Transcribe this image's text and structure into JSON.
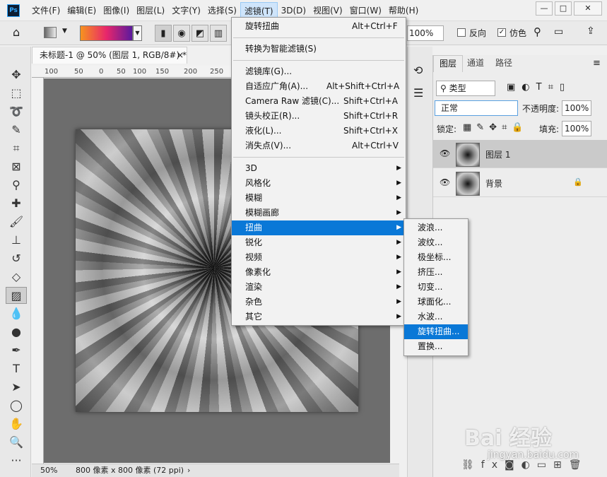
{
  "menubar": {
    "logo": "Ps",
    "items": [
      "文件(F)",
      "编辑(E)",
      "图像(I)",
      "图层(L)",
      "文字(Y)",
      "选择(S)",
      "滤镜(T)",
      "3D(D)",
      "视图(V)",
      "窗口(W)",
      "帮助(H)"
    ],
    "active_index": 6,
    "window_buttons": [
      "—",
      "□",
      "✕"
    ]
  },
  "options": {
    "zoom": "100%",
    "reverse": "反向",
    "dither": "仿色"
  },
  "document": {
    "tab_title": "未标题-1 @ 50% (图层 1, RGB/8#) *",
    "ruler_ticks": [
      "100",
      "50",
      "0",
      "50",
      "100",
      "150",
      "200",
      "250"
    ],
    "status_zoom": "50%",
    "status_info": "800 像素 x 800 像素 (72 ppi)"
  },
  "filter_menu": {
    "items": [
      {
        "label": "旋转扭曲",
        "shortcut": "Alt+Ctrl+F"
      },
      {
        "label": "转换为智能滤镜(S)",
        "shortcut": ""
      },
      {
        "label": "滤镜库(G)...",
        "shortcut": ""
      },
      {
        "label": "自适应广角(A)...",
        "shortcut": "Alt+Shift+Ctrl+A"
      },
      {
        "label": "Camera Raw 滤镜(C)...",
        "shortcut": "Shift+Ctrl+A"
      },
      {
        "label": "镜头校正(R)...",
        "shortcut": "Shift+Ctrl+R"
      },
      {
        "label": "液化(L)...",
        "shortcut": "Shift+Ctrl+X"
      },
      {
        "label": "消失点(V)...",
        "shortcut": "Alt+Ctrl+V"
      },
      {
        "label": "3D",
        "shortcut": ""
      },
      {
        "label": "风格化",
        "shortcut": ""
      },
      {
        "label": "模糊",
        "shortcut": ""
      },
      {
        "label": "模糊画廊",
        "shortcut": ""
      },
      {
        "label": "扭曲",
        "shortcut": ""
      },
      {
        "label": "锐化",
        "shortcut": ""
      },
      {
        "label": "视频",
        "shortcut": ""
      },
      {
        "label": "像素化",
        "shortcut": ""
      },
      {
        "label": "渲染",
        "shortcut": ""
      },
      {
        "label": "杂色",
        "shortcut": ""
      },
      {
        "label": "其它",
        "shortcut": ""
      }
    ]
  },
  "distort_submenu": {
    "items": [
      "波浪...",
      "波纹...",
      "极坐标...",
      "挤压...",
      "切变...",
      "球面化...",
      "水波...",
      "旋转扭曲...",
      "置换..."
    ],
    "highlighted_index": 7
  },
  "layers_panel": {
    "tabs": [
      "图层",
      "通道",
      "路径"
    ],
    "filter_label": "类型",
    "blend_mode": "正常",
    "opacity_label": "不透明度:",
    "opacity_value": "100%",
    "lock_label": "锁定:",
    "fill_label": "填充:",
    "fill_value": "100%",
    "layers": [
      {
        "name": "图层 1",
        "selected": true,
        "locked": false
      },
      {
        "name": "背景",
        "selected": false,
        "locked": true
      }
    ]
  },
  "watermark": {
    "brand": "Bai 经验",
    "url": "jingyan.baidu.com"
  },
  "colors": {
    "highlight": "#0a78d7",
    "canvas_bg": "#6d6d6d"
  }
}
